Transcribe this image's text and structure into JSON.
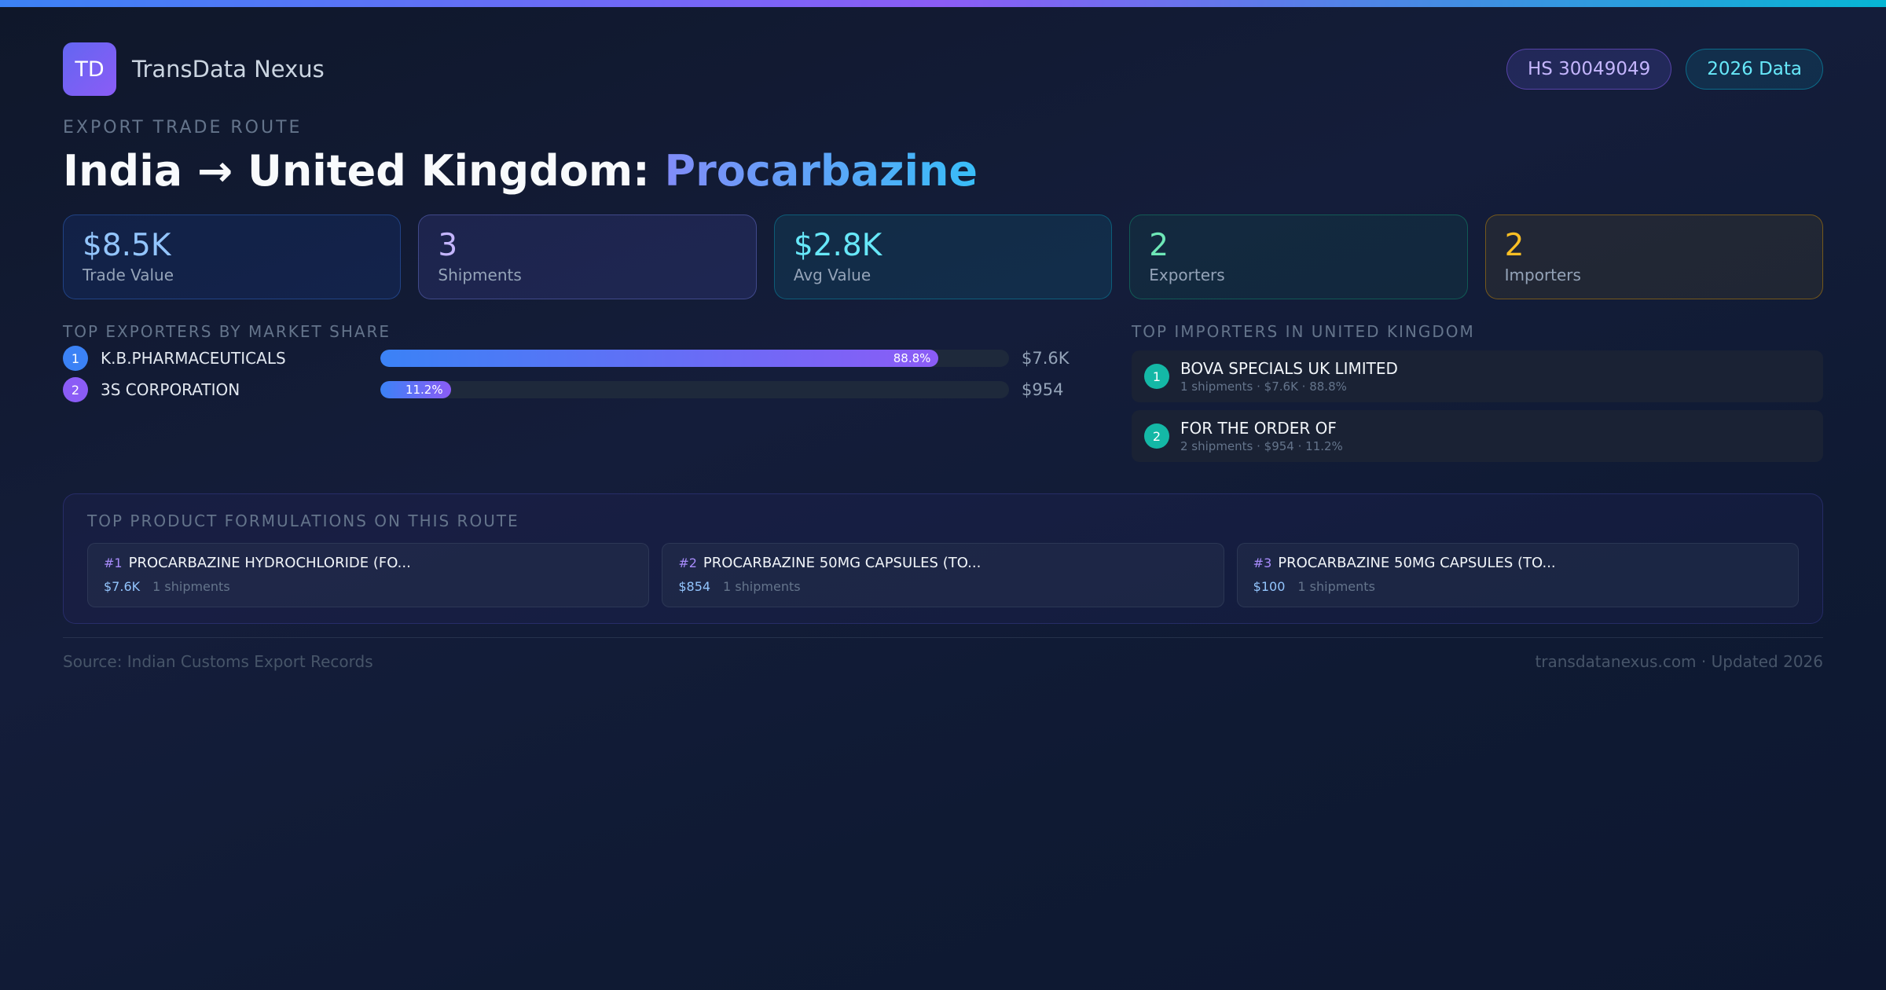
{
  "brand": {
    "logo": "TD",
    "name": "TransData Nexus"
  },
  "badges": {
    "hs": "HS 30049049",
    "year": "2026 Data"
  },
  "eyebrow": "EXPORT TRADE ROUTE",
  "title": {
    "route": "India → United Kingdom: ",
    "product": "Procarbazine"
  },
  "stats": [
    {
      "value": "$8.5K",
      "label": "Trade Value"
    },
    {
      "value": "3",
      "label": "Shipments"
    },
    {
      "value": "$2.8K",
      "label": "Avg Value"
    },
    {
      "value": "2",
      "label": "Exporters"
    },
    {
      "value": "2",
      "label": "Importers"
    }
  ],
  "exporters": {
    "title": "TOP EXPORTERS BY MARKET SHARE",
    "items": [
      {
        "rank": "1",
        "name": "K.B.PHARMACEUTICALS",
        "share": 88.8,
        "share_label": "88.8%",
        "value": "$7.6K"
      },
      {
        "rank": "2",
        "name": "3S CORPORATION",
        "share": 11.2,
        "share_label": "11.2%",
        "value": "$954"
      }
    ]
  },
  "importers": {
    "title": "TOP IMPORTERS IN UNITED KINGDOM",
    "items": [
      {
        "rank": "1",
        "name": "BOVA SPECIALS UK LIMITED",
        "meta": "1 shipments · $7.6K · 88.8%"
      },
      {
        "rank": "2",
        "name": "FOR THE ORDER OF",
        "meta": "2 shipments · $954 · 11.2%"
      }
    ]
  },
  "products": {
    "title": "TOP PRODUCT FORMULATIONS ON THIS ROUTE",
    "items": [
      {
        "num": "#1",
        "name": "PROCARBAZINE HYDROCHLORIDE (FO...",
        "value": "$7.6K",
        "shipments": "1 shipments"
      },
      {
        "num": "#2",
        "name": "PROCARBAZINE 50MG CAPSULES (TO...",
        "value": "$854",
        "shipments": "1 shipments"
      },
      {
        "num": "#3",
        "name": "PROCARBAZINE 50MG CAPSULES (TO...",
        "value": "$100",
        "shipments": "1 shipments"
      }
    ]
  },
  "footer": {
    "source": "Source: Indian Customs Export Records",
    "site": "transdatanexus.com · Updated 2026"
  }
}
